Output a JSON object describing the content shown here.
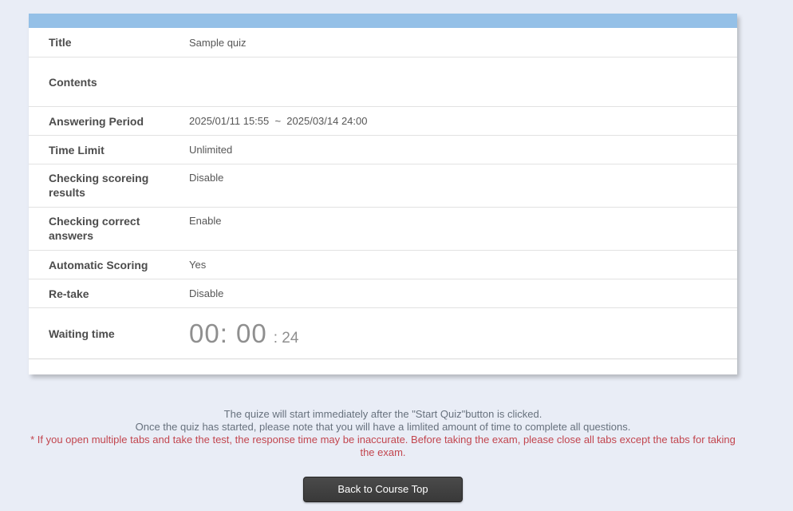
{
  "colors": {
    "page_background": "#e9edf6",
    "panel_header": "#94c0e7",
    "warning_text": "#c2454e",
    "note_text": "#67717d",
    "button_background": "#3e3e3e",
    "button_text": "#ffffff",
    "clock_text": "#8f8f8f"
  },
  "panel": {
    "rows": [
      {
        "label": "Title",
        "value": "Sample quiz"
      },
      {
        "label": "Contents",
        "value": ""
      },
      {
        "label": "Answering Period",
        "value": "2025/01/11 15:55  ~  2025/03/14 24:00"
      },
      {
        "label": "Time Limit",
        "value": "Unlimited"
      },
      {
        "label": "Checking scoreing results",
        "value": "Disable"
      },
      {
        "label": "Checking correct answers",
        "value": "Enable"
      },
      {
        "label": "Automatic Scoring",
        "value": "Yes"
      },
      {
        "label": "Re-take",
        "value": "Disable"
      },
      {
        "label": "Waiting time",
        "clock_main": "00: 00",
        "clock_seconds": ": 24",
        "clock_hours": "00",
        "clock_minutes": "00",
        "clock_seconds_value": "24"
      }
    ]
  },
  "footer": {
    "note1": "The quize will start immediately after the \"Start Quiz\"button is clicked.",
    "note2": "Once the quiz has started, please note that you will have a limlited amount of time to complete all questions.",
    "warning": "* If you open multiple tabs and take the test, the response time may be inaccurate. Before taking the exam, please close all tabs except the tabs for taking the exam.",
    "back_button": "Back to Course Top"
  }
}
